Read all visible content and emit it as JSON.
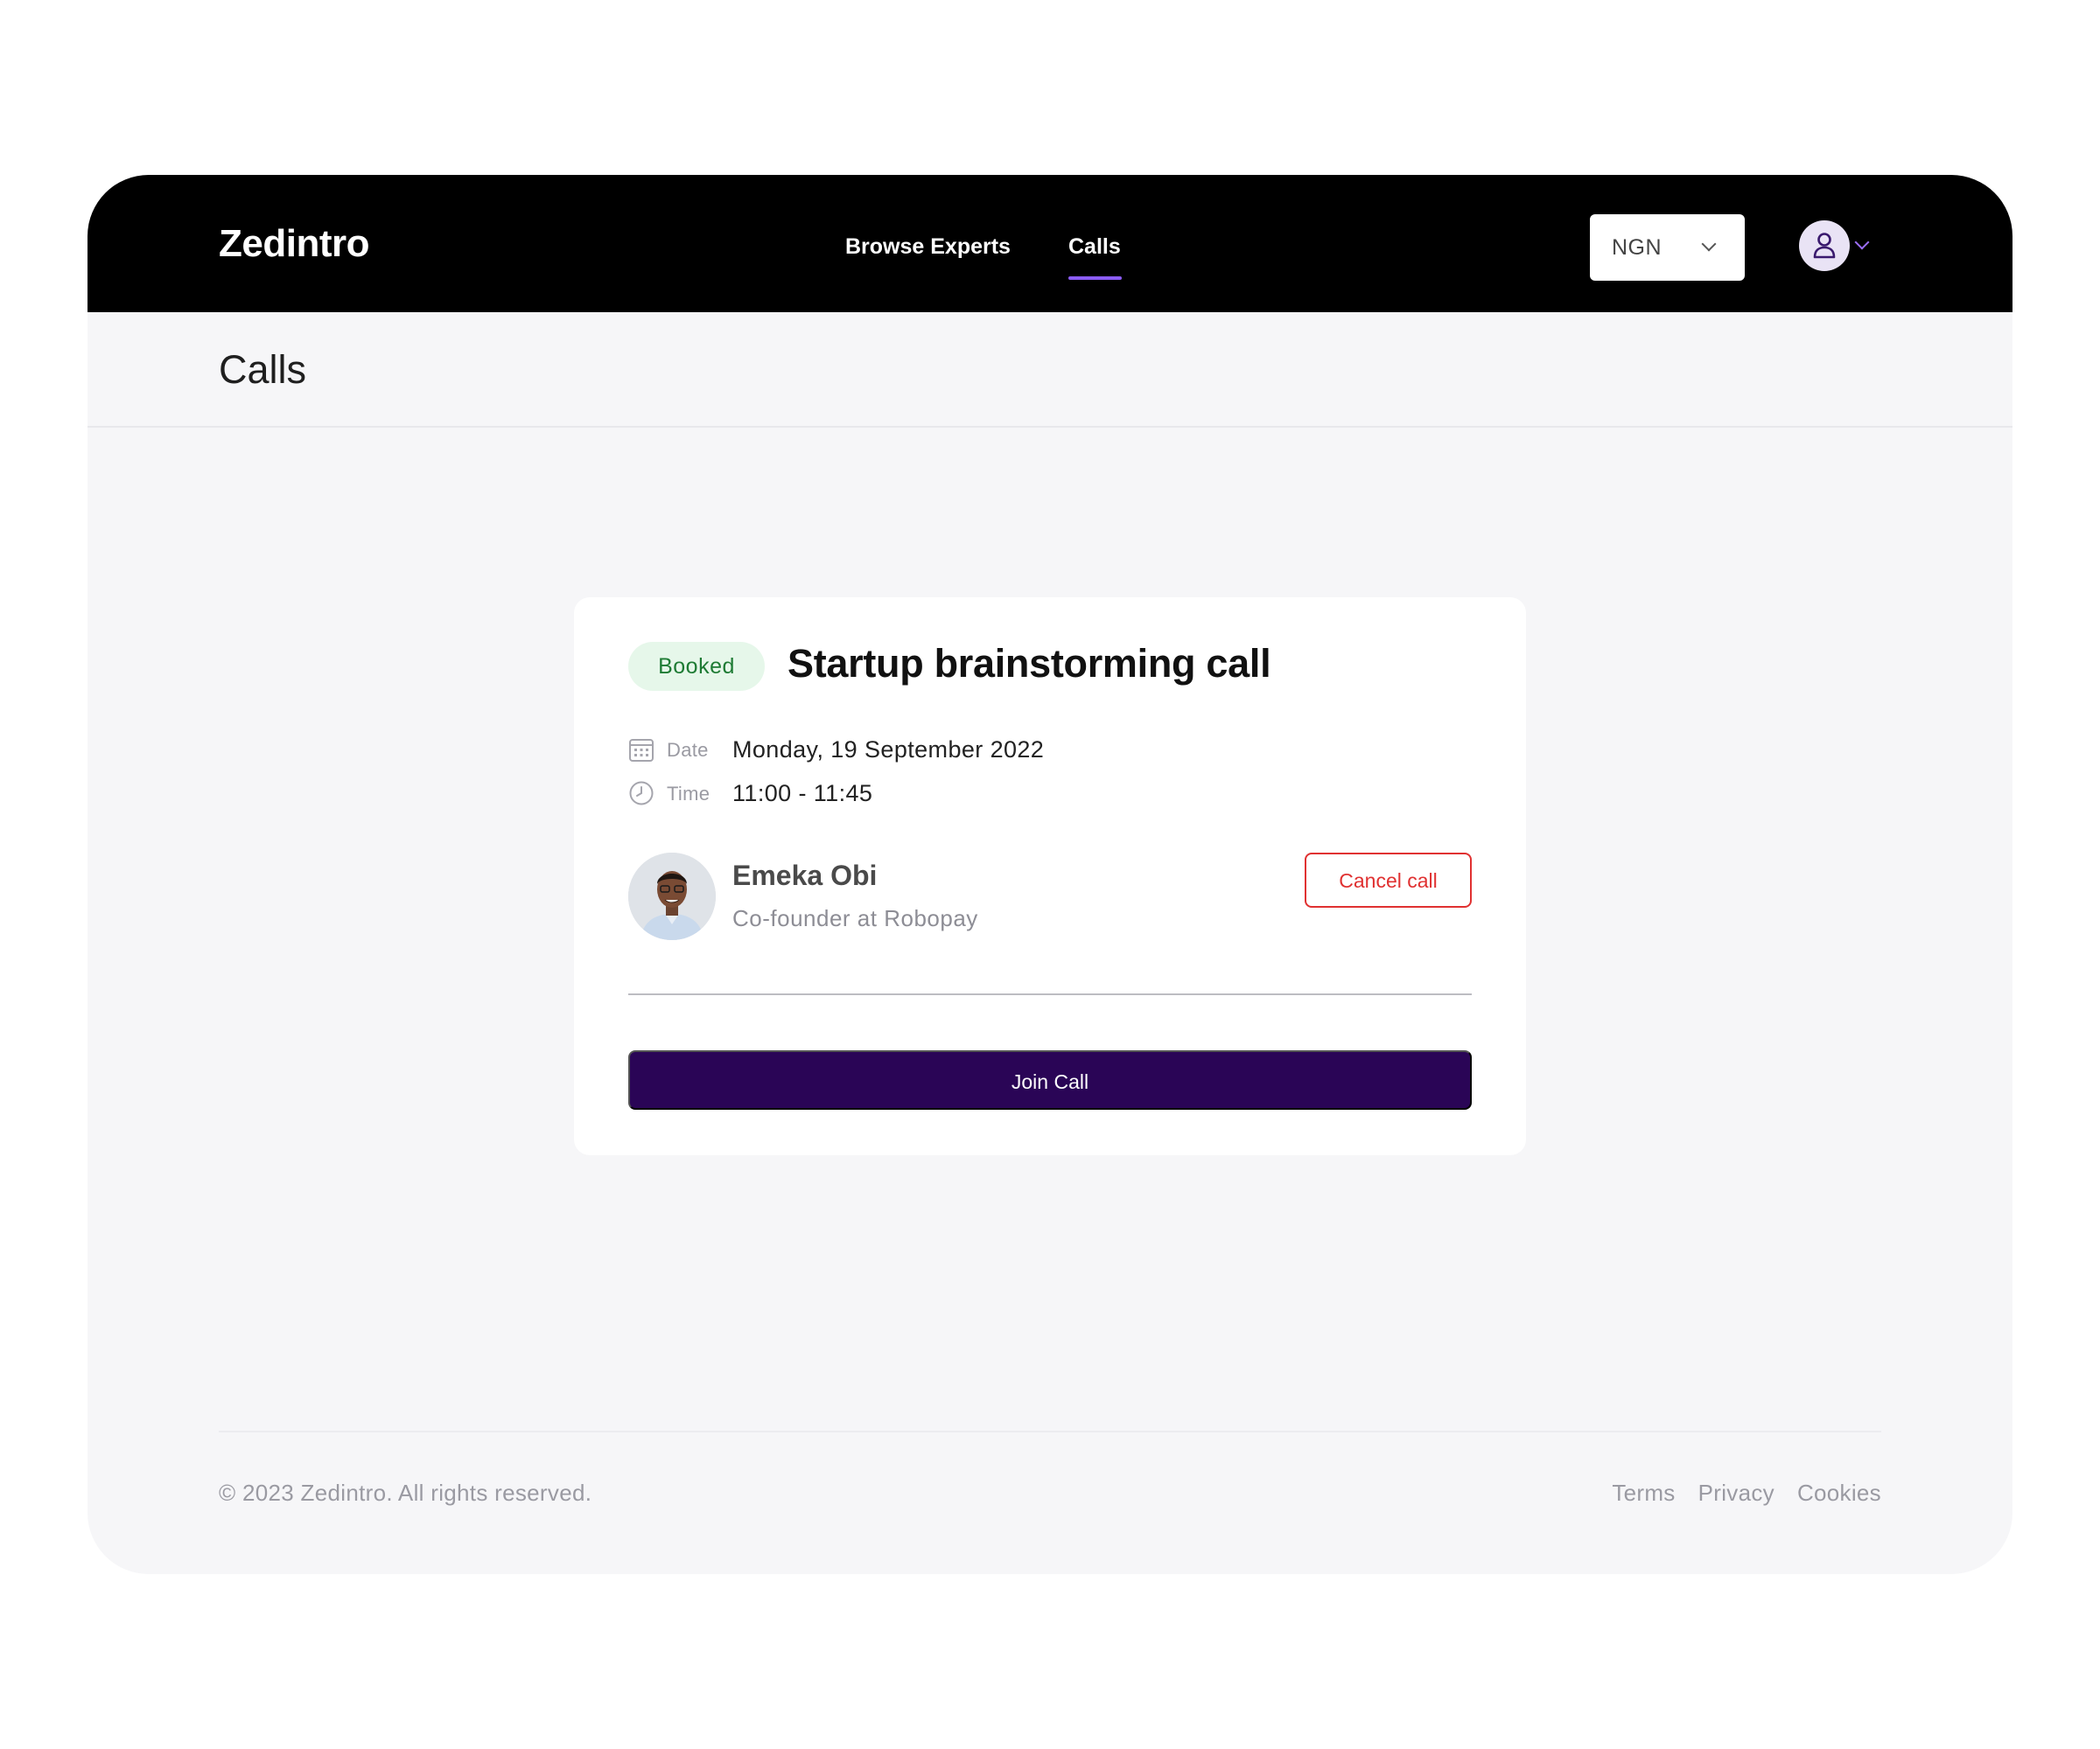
{
  "app": {
    "name": "Zedintro"
  },
  "nav": {
    "links": [
      {
        "label": "Browse Experts",
        "active": false
      },
      {
        "label": "Calls",
        "active": true
      }
    ],
    "accent_color": "#8b5cf6"
  },
  "currency": {
    "selected": "NGN"
  },
  "user_menu": {
    "icon": "user-icon"
  },
  "page": {
    "title": "Calls"
  },
  "call": {
    "status": "Booked",
    "status_color": "#1e7b34",
    "title": "Startup brainstorming call",
    "date_label": "Date",
    "date_value": "Monday, 19 September 2022",
    "time_label": "Time",
    "time_value": "11:00 - 11:45",
    "expert": {
      "name": "Emeka Obi",
      "role": "Co-founder at Robopay"
    },
    "cancel_label": "Cancel call",
    "cancel_color": "#e03131",
    "join_label": "Join Call",
    "join_color": "#2a0556"
  },
  "footer": {
    "copyright": "© 2023 Zedintro. All rights reserved.",
    "links": [
      "Terms",
      "Privacy",
      "Cookies"
    ]
  }
}
